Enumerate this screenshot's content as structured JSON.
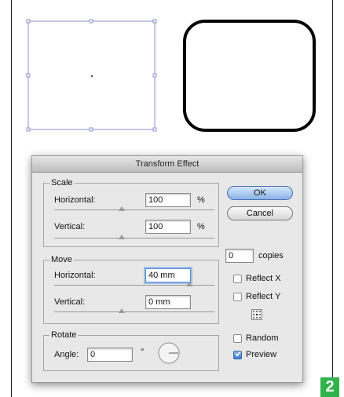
{
  "dialog": {
    "title": "Transform Effect",
    "scale": {
      "group_label": "Scale",
      "horizontal_label": "Horizontal:",
      "horizontal_value": "100",
      "horizontal_unit": "%",
      "vertical_label": "Vertical:",
      "vertical_value": "100",
      "vertical_unit": "%"
    },
    "move": {
      "group_label": "Move",
      "horizontal_label": "Horizontal:",
      "horizontal_value": "40 mm",
      "vertical_label": "Vertical:",
      "vertical_value": "0 mm"
    },
    "rotate": {
      "group_label": "Rotate",
      "angle_label": "Angle:",
      "angle_value": "0",
      "angle_unit": "°"
    },
    "buttons": {
      "ok": "OK",
      "cancel": "Cancel"
    },
    "copies": {
      "value": "0",
      "label": "copies"
    },
    "options": {
      "reflect_x": {
        "label": "Reflect X",
        "checked": false
      },
      "reflect_y": {
        "label": "Reflect Y",
        "checked": false
      },
      "random": {
        "label": "Random",
        "checked": false
      },
      "preview": {
        "label": "Preview",
        "checked": true
      }
    }
  },
  "badge": "2",
  "colors": {
    "selection": "#8a90d0",
    "badge": "#2fb34a",
    "default_button": "#89b1e6"
  }
}
